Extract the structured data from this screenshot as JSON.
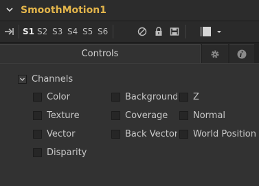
{
  "header": {
    "title": "SmoothMotion1"
  },
  "toolbar": {
    "views": [
      "S1",
      "S2",
      "S3",
      "S4",
      "S5",
      "S6"
    ],
    "active_view": "S1",
    "icons": [
      "pin-icon",
      "disable-icon",
      "lock-icon",
      "save-icon",
      "color-swatch-icon",
      "dropdown-chevron-icon"
    ]
  },
  "tabs": {
    "controls_label": "Controls",
    "icon_tabs": [
      "gear-icon",
      "info-icon"
    ]
  },
  "channels": {
    "group_label": "Channels",
    "group_checked": true,
    "items": [
      {
        "label": "Color",
        "checked": false
      },
      {
        "label": "Background",
        "checked": false
      },
      {
        "label": "Z",
        "checked": false
      },
      {
        "label": "Texture",
        "checked": false
      },
      {
        "label": "Coverage",
        "checked": false
      },
      {
        "label": "Normal",
        "checked": false
      },
      {
        "label": "Vector",
        "checked": false
      },
      {
        "label": "Back Vector",
        "checked": false
      },
      {
        "label": "World Position",
        "checked": false
      },
      {
        "label": "Disparity",
        "checked": false
      }
    ]
  },
  "colors": {
    "title": "#e3b54b",
    "panel_bg": "#323232",
    "dark_bg": "#232323",
    "text": "#c8c8c8"
  }
}
